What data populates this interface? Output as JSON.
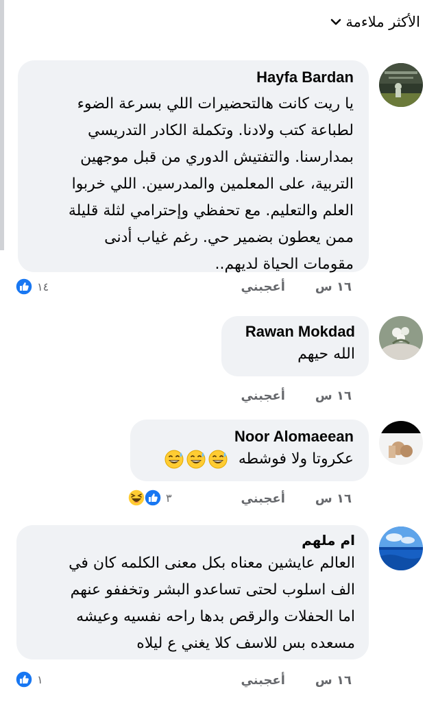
{
  "sort": {
    "label": "الأكثر ملاءمة"
  },
  "colors": {
    "like_blue": "#1877f2",
    "bubble": "#f0f2f5",
    "meta_gray": "#65676b"
  },
  "comments": [
    {
      "author": "Hayfa Bardan",
      "lines": [
        "يا ريت كانت هالتحضيرات اللي بسرعة الضوء",
        "لطباعة كتب ولادنا. وتكملة الكادر التدريسي",
        "بمدارسنا. والتفتيش الدوري من قبل موجهين",
        "التربية، على المعلمين والمدرسين. اللي خربوا",
        "العلم والتعليم. مع تحفظي وإحترامي لثلة قليلة",
        "ممن يعطون بضمير حي. رغم غياب أدنى",
        "مقومات الحياة لديهم.."
      ],
      "time": "١٦ س",
      "like_label": "أعجبني",
      "reaction_count": "١٤",
      "reactions": [
        "like-icon"
      ]
    },
    {
      "author": "Rawan Mokdad",
      "lines": [
        "الله حيهم"
      ],
      "time": "١٦ س",
      "like_label": "أعجبني"
    },
    {
      "author": "Noor Alomaeean",
      "text": "عكروتا ولا فوشطه",
      "emojis": [
        "sweat-smile-emoji",
        "sweat-smile-emoji",
        "sweat-smile-emoji"
      ],
      "time": "١٦ س",
      "like_label": "أعجبني",
      "reaction_count": "٣",
      "reactions": [
        "like-icon",
        "haha-icon"
      ]
    },
    {
      "author": "ام ملهم",
      "lines": [
        "العالم عايشين معناه بكل معنى الكلمه كان في",
        "الف اسلوب لحتى تساعدو البشر وتخففو عنهم",
        "اما الحفلات والرقص بدها راحه نفسيه وعيشه",
        "مسعده بس للاسف كلا يغني ع ليلاه"
      ],
      "time": "١٦ س",
      "like_label": "أعجبني",
      "reaction_count": "١",
      "reactions": [
        "like-icon"
      ]
    }
  ]
}
